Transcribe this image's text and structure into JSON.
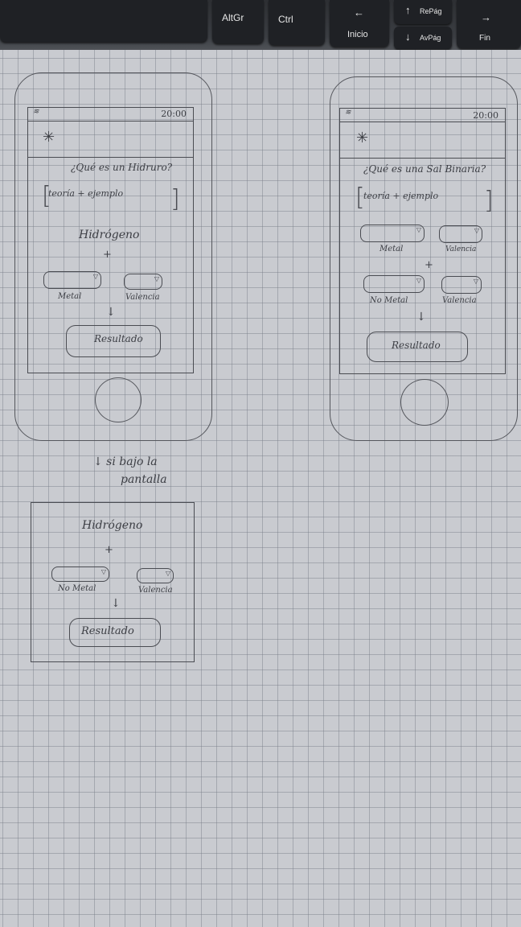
{
  "keyboard": {
    "altgr": "AltGr",
    "ctrl": "Ctrl",
    "inicio": "Inicio",
    "repag": "RePág",
    "avpag": "AvPág",
    "fin": "Fin"
  },
  "phone_left": {
    "time": "20:00",
    "question": "¿Qué es un Hidruro?",
    "theory": "teoría + ejemplo",
    "element": "Hidrógeno",
    "plus": "+",
    "dropdown1_label": "Metal",
    "dropdown2_label": "Valencia",
    "arrow": "↓",
    "result_button": "Resultado"
  },
  "phone_right": {
    "time": "20:00",
    "question": "¿Qué es una Sal Binaria?",
    "theory": "teoría + ejemplo",
    "dropdown1_label": "Metal",
    "dropdown2_label": "Valencia",
    "plus": "+",
    "dropdown3_label": "No Metal",
    "dropdown4_label": "Valencia",
    "arrow": "↓",
    "result_button": "Resultado"
  },
  "scroll_note": {
    "line1": "↓ si bajo la",
    "line2": "pantalla"
  },
  "scrolled_screen": {
    "element": "Hidrógeno",
    "plus": "+",
    "dropdown1_label": "No Metal",
    "dropdown2_label": "Valencia",
    "arrow": "↓",
    "result_button": "Resultado"
  }
}
